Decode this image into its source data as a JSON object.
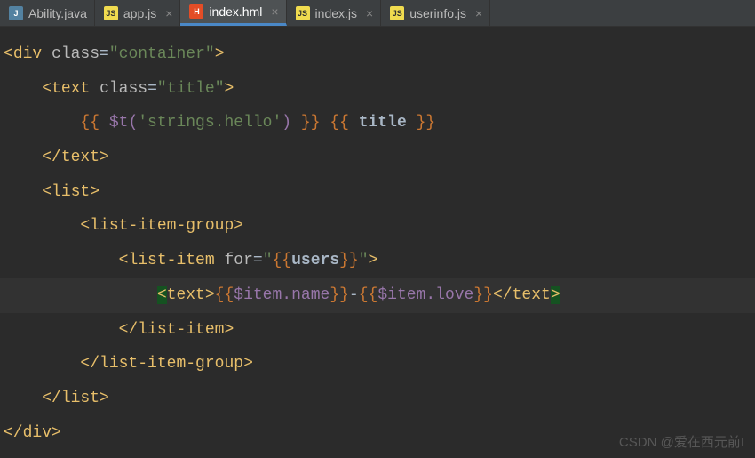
{
  "tabs": [
    {
      "label": "Ability.java",
      "icon": "java",
      "active": false,
      "closable": false
    },
    {
      "label": "app.js",
      "icon": "js",
      "active": false,
      "closable": true
    },
    {
      "label": "index.hml",
      "icon": "hml",
      "active": true,
      "closable": true
    },
    {
      "label": "index.js",
      "icon": "js",
      "active": false,
      "closable": true
    },
    {
      "label": "userinfo.js",
      "icon": "js",
      "active": false,
      "closable": true
    }
  ],
  "code": {
    "l1": {
      "open": "<",
      "tag": "div",
      "sp": " ",
      "attr": "class",
      "eq": "=",
      "q1": "\"",
      "val": "container",
      "q2": "\"",
      "close": ">"
    },
    "l2": {
      "indent": "    ",
      "open": "<",
      "tag": "text",
      "sp": " ",
      "attr": "class",
      "eq": "=",
      "q1": "\"",
      "val": "title",
      "q2": "\"",
      "close": ">"
    },
    "l3": {
      "indent": "        ",
      "mo1": "{{",
      "sp1": " ",
      "expr1": "$t(",
      "str": "'strings.hello'",
      "expr1b": ")",
      "sp2": " ",
      "mc1": "}}",
      "sp3": " ",
      "mo2": "{{",
      "sp4": " ",
      "ident": "title",
      "sp5": " ",
      "mc2": "}}"
    },
    "l4": {
      "indent": "    ",
      "open": "</",
      "tag": "text",
      "close": ">"
    },
    "l5": {
      "indent": "    ",
      "open": "<",
      "tag": "list",
      "close": ">"
    },
    "l6": {
      "indent": "        ",
      "open": "<",
      "tag": "list-item-group",
      "close": ">"
    },
    "l7": {
      "indent": "            ",
      "open": "<",
      "tag": "list-item",
      "sp": " ",
      "attr": "for",
      "eq": "=",
      "q1": "\"",
      "mo": "{{",
      "ident": "users",
      "mc": "}}",
      "q2": "\"",
      "close": ">"
    },
    "l8": {
      "indent": "                ",
      "open": "<",
      "tag": "text",
      "close1": ">",
      "mo1": "{{",
      "expr1": "$item.name",
      "mc1": "}}",
      "dash": "-",
      "mo2": "{{",
      "expr2": "$item.love",
      "mc2": "}}",
      "open2": "</",
      "tag2": "text",
      "close2": ">"
    },
    "l9": {
      "indent": "            ",
      "open": "</",
      "tag": "list-item",
      "close": ">"
    },
    "l10": {
      "indent": "        ",
      "open": "</",
      "tag": "list-item-group",
      "close": ">"
    },
    "l11": {
      "indent": "    ",
      "open": "</",
      "tag": "list",
      "close": ">"
    },
    "l12": {
      "open": "</",
      "tag": "div",
      "close": ">"
    }
  },
  "icons": {
    "java": "J",
    "js": "JS",
    "hml": "H"
  },
  "close_glyph": "×",
  "watermark": "CSDN @爱在西元前I"
}
